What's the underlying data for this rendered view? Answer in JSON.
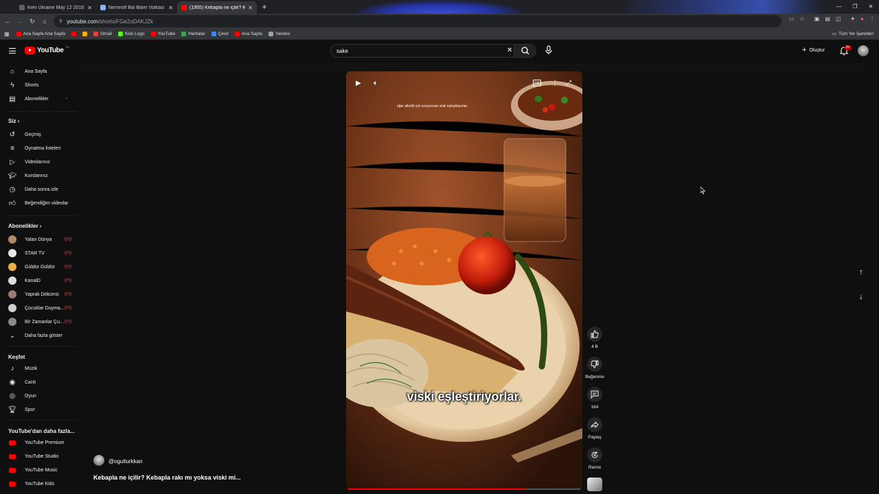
{
  "browser": {
    "tabs": [
      {
        "title": "Kiev Ukraine May 12 2016 Nem",
        "color": "#5f6368"
      },
      {
        "title": "Nemiroff Bal Biber Votkası » Th",
        "color": "#8ab4f8"
      },
      {
        "title": "(1955) Kebapla ne içilir? Kebapla",
        "color": "#ff0000"
      }
    ],
    "url_host": "youtube.com",
    "url_path": "/shorts/FGe2oDAKJZk",
    "bookmarks": [
      {
        "label": "Ana Sayfa Ana Sayfa",
        "color": "#ff0000"
      },
      {
        "label": "",
        "color": "#ff0000"
      },
      {
        "label": "",
        "color": "#f9ab00"
      },
      {
        "label": "Gmail",
        "color": "#ea4335"
      },
      {
        "label": "Kick Logo",
        "color": "#53fc18"
      },
      {
        "label": "YouTube",
        "color": "#ff0000"
      },
      {
        "label": "Haritalar",
        "color": "#34a853"
      },
      {
        "label": "Çevir",
        "color": "#4285f4"
      },
      {
        "label": "Ana Sayfa",
        "color": "#ff0000"
      },
      {
        "label": "Yandex",
        "color": "#9aa0a6"
      }
    ],
    "all_bookmarks": "Tüm Yer İşaretleri"
  },
  "header": {
    "logo_text": "YouTube",
    "logo_country": "TR",
    "search_value": "sake",
    "create_label": "Oluştur",
    "notif_badge": "9+"
  },
  "sidebar": {
    "main": [
      {
        "label": "Ana Sayfa",
        "icon": "home-icon"
      },
      {
        "label": "Shorts",
        "icon": "shorts-icon"
      },
      {
        "label": "Abonelikler",
        "icon": "subscriptions-icon"
      }
    ],
    "you_head": "Siz",
    "you": [
      {
        "label": "Geçmiş",
        "icon": "history-icon"
      },
      {
        "label": "Oynatma listeleri",
        "icon": "playlists-icon"
      },
      {
        "label": "Videolarınız",
        "icon": "your-videos-icon"
      },
      {
        "label": "Kurslarınız",
        "icon": "courses-icon"
      },
      {
        "label": "Daha sonra izle",
        "icon": "watch-later-icon"
      },
      {
        "label": "Beğendiğim videolar",
        "icon": "liked-icon"
      }
    ],
    "subs_head": "Abonelikler",
    "subs": [
      {
        "label": "Yalan Dünya",
        "color": "#b08a6a"
      },
      {
        "label": "STAR TV",
        "color": "#e8e8e8"
      },
      {
        "label": "Güldür Güldür",
        "color": "#e8b04a"
      },
      {
        "label": "KanalD",
        "color": "#dddddd"
      },
      {
        "label": "Yaprak Dökümü",
        "color": "#a07a70"
      },
      {
        "label": "Çocuklar Duyma...",
        "color": "#cfcfcf"
      },
      {
        "label": "Bir Zamanlar Çu...",
        "color": "#8a8a8a"
      }
    ],
    "more_label": "Daha fazla göster",
    "explore_head": "Keşfet",
    "explore": [
      {
        "label": "Müzik",
        "icon": "music-icon"
      },
      {
        "label": "Canlı",
        "icon": "live-icon"
      },
      {
        "label": "Oyun",
        "icon": "gaming-icon"
      },
      {
        "label": "Spor",
        "icon": "sports-icon"
      }
    ],
    "more_yt_head": "YouTube'dan daha fazla...",
    "more_yt": [
      {
        "label": "YouTube Premium",
        "color": "#ff0000"
      },
      {
        "label": "YouTube Studio",
        "color": "#ff0000"
      },
      {
        "label": "YouTube Music",
        "color": "#ff0000"
      },
      {
        "label": "YouTube Kids",
        "color": "#ff0000"
      }
    ]
  },
  "short": {
    "small_caption": "eğer alkollü içki soruyorsan viski eşleştiriyorlar.",
    "big_caption": "viski eşleştiriyorlar.",
    "progress": 0.76,
    "channel": "@ogulturkkan",
    "title": "Kebapla ne içilir? Kebapla rakı mı yoksa viski mi...",
    "actions": {
      "like_count": "4 B",
      "dislike_label": "Beğenme",
      "comments_count": "164",
      "share_label": "Paylaş",
      "remix_label": "Remix"
    }
  }
}
